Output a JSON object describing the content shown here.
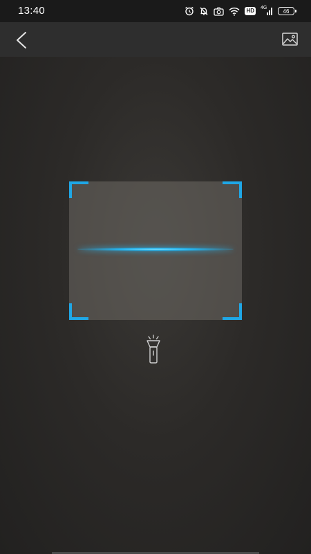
{
  "status_bar": {
    "time": "13:40",
    "hd_label": "HD",
    "network_type": "4G",
    "battery_level": "46"
  },
  "icons": {
    "back": "chevron-left-icon",
    "gallery": "image-icon",
    "flashlight": "flashlight-icon",
    "alarm": "alarm-icon",
    "mute": "bell-off-icon",
    "camera": "camera-icon",
    "wifi": "wifi-icon",
    "signal": "signal-icon"
  },
  "colors": {
    "accent": "#1fa7e6",
    "status_bar_bg": "#1a1a1a",
    "app_bar_bg": "#2e2e2e",
    "background": "#2c2a28"
  }
}
